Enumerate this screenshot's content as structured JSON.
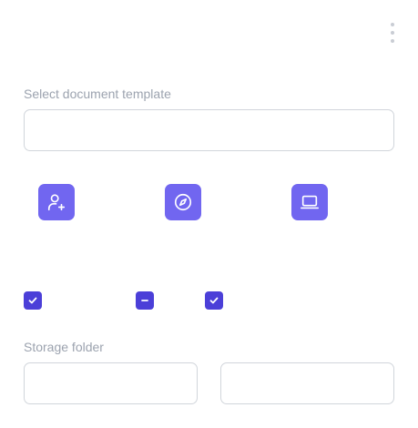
{
  "menu": {
    "icon": "more-vertical-icon"
  },
  "template_section": {
    "label": "Select document template",
    "input_value": "",
    "placeholder": ""
  },
  "actions": [
    {
      "icon": "user-plus-icon"
    },
    {
      "icon": "compass-icon"
    },
    {
      "icon": "laptop-icon"
    }
  ],
  "checkboxes": [
    {
      "state": "checked"
    },
    {
      "state": "indeterminate"
    },
    {
      "state": "checked"
    }
  ],
  "storage_section": {
    "label": "Storage folder",
    "inputs": [
      {
        "value": "",
        "placeholder": ""
      },
      {
        "value": "",
        "placeholder": ""
      }
    ]
  },
  "colors": {
    "icon_tile": "#7166f0",
    "checkbox": "#4b3fd8",
    "label": "#9ca3af",
    "border": "#d1d5db"
  }
}
